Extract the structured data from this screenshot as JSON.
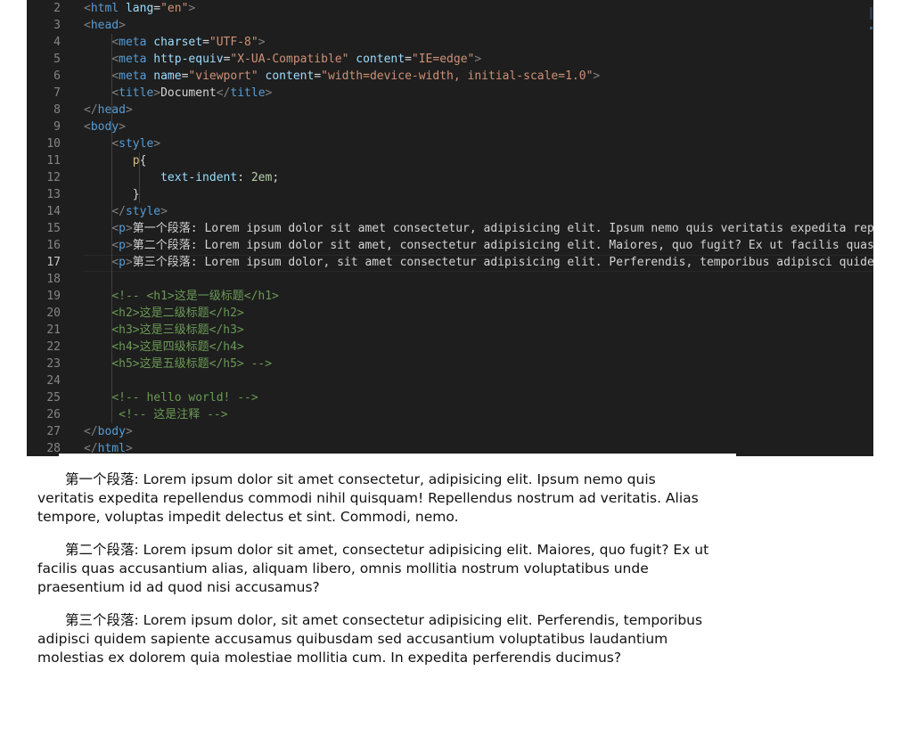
{
  "editor": {
    "lines": [
      {
        "n": "2",
        "segments": [
          {
            "c": "br",
            "t": "<"
          },
          {
            "c": "tag",
            "t": "html"
          },
          {
            "c": "txt",
            "t": " "
          },
          {
            "c": "attr",
            "t": "lang"
          },
          {
            "c": "txt",
            "t": "="
          },
          {
            "c": "str",
            "t": "\"en\""
          },
          {
            "c": "br",
            "t": ">"
          }
        ]
      },
      {
        "n": "3",
        "segments": [
          {
            "c": "br",
            "t": "<"
          },
          {
            "c": "tag",
            "t": "head"
          },
          {
            "c": "br",
            "t": ">"
          }
        ]
      },
      {
        "n": "4",
        "segments": [
          {
            "c": "txt",
            "t": "    "
          },
          {
            "c": "br",
            "t": "<"
          },
          {
            "c": "tag",
            "t": "meta"
          },
          {
            "c": "txt",
            "t": " "
          },
          {
            "c": "attr",
            "t": "charset"
          },
          {
            "c": "txt",
            "t": "="
          },
          {
            "c": "str",
            "t": "\"UTF-8\""
          },
          {
            "c": "br",
            "t": ">"
          }
        ]
      },
      {
        "n": "5",
        "segments": [
          {
            "c": "txt",
            "t": "    "
          },
          {
            "c": "br",
            "t": "<"
          },
          {
            "c": "tag",
            "t": "meta"
          },
          {
            "c": "txt",
            "t": " "
          },
          {
            "c": "attr",
            "t": "http-equiv"
          },
          {
            "c": "txt",
            "t": "="
          },
          {
            "c": "str",
            "t": "\"X-UA-Compatible\""
          },
          {
            "c": "txt",
            "t": " "
          },
          {
            "c": "attr",
            "t": "content"
          },
          {
            "c": "txt",
            "t": "="
          },
          {
            "c": "str",
            "t": "\"IE=edge\""
          },
          {
            "c": "br",
            "t": ">"
          }
        ]
      },
      {
        "n": "6",
        "segments": [
          {
            "c": "txt",
            "t": "    "
          },
          {
            "c": "br",
            "t": "<"
          },
          {
            "c": "tag",
            "t": "meta"
          },
          {
            "c": "txt",
            "t": " "
          },
          {
            "c": "attr",
            "t": "name"
          },
          {
            "c": "txt",
            "t": "="
          },
          {
            "c": "str",
            "t": "\"viewport\""
          },
          {
            "c": "txt",
            "t": " "
          },
          {
            "c": "attr",
            "t": "content"
          },
          {
            "c": "txt",
            "t": "="
          },
          {
            "c": "str",
            "t": "\"width=device-width, initial-scale=1.0\""
          },
          {
            "c": "br",
            "t": ">"
          }
        ]
      },
      {
        "n": "7",
        "segments": [
          {
            "c": "txt",
            "t": "    "
          },
          {
            "c": "br",
            "t": "<"
          },
          {
            "c": "tag",
            "t": "title"
          },
          {
            "c": "br",
            "t": ">"
          },
          {
            "c": "txt",
            "t": "Document"
          },
          {
            "c": "br",
            "t": "</"
          },
          {
            "c": "tag",
            "t": "title"
          },
          {
            "c": "br",
            "t": ">"
          }
        ]
      },
      {
        "n": "8",
        "segments": [
          {
            "c": "br",
            "t": "</"
          },
          {
            "c": "tag",
            "t": "head"
          },
          {
            "c": "br",
            "t": ">"
          }
        ]
      },
      {
        "n": "9",
        "segments": [
          {
            "c": "br",
            "t": "<"
          },
          {
            "c": "tag",
            "t": "body"
          },
          {
            "c": "br",
            "t": ">"
          }
        ]
      },
      {
        "n": "10",
        "segments": [
          {
            "c": "txt",
            "t": "    "
          },
          {
            "c": "br",
            "t": "<"
          },
          {
            "c": "tag",
            "t": "style"
          },
          {
            "c": "br",
            "t": ">"
          }
        ]
      },
      {
        "n": "11",
        "segments": [
          {
            "c": "txt",
            "t": "       "
          },
          {
            "c": "sel",
            "t": "p"
          },
          {
            "c": "txt",
            "t": "{"
          }
        ]
      },
      {
        "n": "12",
        "segments": [
          {
            "c": "txt",
            "t": "           "
          },
          {
            "c": "prop",
            "t": "text-indent"
          },
          {
            "c": "txt",
            "t": ": "
          },
          {
            "c": "num",
            "t": "2em"
          },
          {
            "c": "txt",
            "t": ";"
          }
        ]
      },
      {
        "n": "13",
        "segments": [
          {
            "c": "txt",
            "t": "       }"
          }
        ]
      },
      {
        "n": "14",
        "segments": [
          {
            "c": "txt",
            "t": "    "
          },
          {
            "c": "br",
            "t": "</"
          },
          {
            "c": "tag",
            "t": "style"
          },
          {
            "c": "br",
            "t": ">"
          }
        ]
      },
      {
        "n": "15",
        "segments": [
          {
            "c": "txt",
            "t": "    "
          },
          {
            "c": "br",
            "t": "<"
          },
          {
            "c": "tag",
            "t": "p"
          },
          {
            "c": "br",
            "t": ">"
          },
          {
            "c": "txt",
            "t": "第一个段落: Lorem ipsum dolor sit amet consectetur, adipisicing elit. Ipsum nemo quis veritatis expedita repellendus"
          }
        ]
      },
      {
        "n": "16",
        "segments": [
          {
            "c": "txt",
            "t": "    "
          },
          {
            "c": "br",
            "t": "<"
          },
          {
            "c": "tag",
            "t": "p"
          },
          {
            "c": "br",
            "t": ">"
          },
          {
            "c": "txt",
            "t": "第二个段落: Lorem ipsum dolor sit amet, consectetur adipisicing elit. Maiores, quo fugit? Ex ut facilis quas"
          }
        ]
      },
      {
        "n": "17",
        "segments": [
          {
            "c": "txt",
            "t": "    "
          },
          {
            "c": "br",
            "t": "<"
          },
          {
            "c": "tag",
            "t": "p"
          },
          {
            "c": "br",
            "t": ">"
          },
          {
            "c": "txt",
            "t": "第三个段落: Lorem ipsum dolor, sit amet consectetur adipisicing elit. Perferendis, temporibus adipisci quidem"
          }
        ]
      },
      {
        "n": "18",
        "segments": []
      },
      {
        "n": "19",
        "segments": [
          {
            "c": "txt",
            "t": "    "
          },
          {
            "c": "cmt",
            "t": "<!-- <h1>这是一级标题</h1>"
          }
        ]
      },
      {
        "n": "20",
        "segments": [
          {
            "c": "txt",
            "t": "    "
          },
          {
            "c": "cmt",
            "t": "<h2>这是二级标题</h2>"
          }
        ]
      },
      {
        "n": "21",
        "segments": [
          {
            "c": "txt",
            "t": "    "
          },
          {
            "c": "cmt",
            "t": "<h3>这是三级标题</h3>"
          }
        ]
      },
      {
        "n": "22",
        "segments": [
          {
            "c": "txt",
            "t": "    "
          },
          {
            "c": "cmt",
            "t": "<h4>这是四级标题</h4>"
          }
        ]
      },
      {
        "n": "23",
        "segments": [
          {
            "c": "txt",
            "t": "    "
          },
          {
            "c": "cmt",
            "t": "<h5>这是五级标题</h5> -->"
          }
        ]
      },
      {
        "n": "24",
        "segments": []
      },
      {
        "n": "25",
        "segments": [
          {
            "c": "txt",
            "t": "    "
          },
          {
            "c": "cmt",
            "t": "<!-- hello world! -->"
          }
        ]
      },
      {
        "n": "26",
        "segments": [
          {
            "c": "txt",
            "t": "     "
          },
          {
            "c": "cmt",
            "t": "<!-- 这是注释 -->"
          }
        ]
      },
      {
        "n": "27",
        "segments": [
          {
            "c": "br",
            "t": "</"
          },
          {
            "c": "tag",
            "t": "body"
          },
          {
            "c": "br",
            "t": ">"
          }
        ]
      },
      {
        "n": "28",
        "segments": [
          {
            "c": "br",
            "t": "</"
          },
          {
            "c": "tag",
            "t": "html"
          },
          {
            "c": "br",
            "t": ">"
          }
        ]
      }
    ],
    "active_line": "17"
  },
  "preview": {
    "paragraphs": [
      "第一个段落: Lorem ipsum dolor sit amet consectetur, adipisicing elit. Ipsum nemo quis veritatis expedita repellendus commodi nihil quisquam! Repellendus nostrum ad veritatis. Alias tempore, voluptas impedit delectus et sint. Commodi, nemo.",
      "第二个段落: Lorem ipsum dolor sit amet, consectetur adipisicing elit. Maiores, quo fugit? Ex ut facilis quas accusantium alias, aliquam libero, omnis mollitia nostrum voluptatibus unde praesentium id ad quod nisi accusamus?",
      "第三个段落: Lorem ipsum dolor, sit amet consectetur adipisicing elit. Perferendis, temporibus adipisci quidem sapiente accusamus quibusdam sed accusantium voluptatibus laudantium molestias ex dolorem quia molestiae mollitia cum. In expedita perferendis ducimus?"
    ]
  }
}
